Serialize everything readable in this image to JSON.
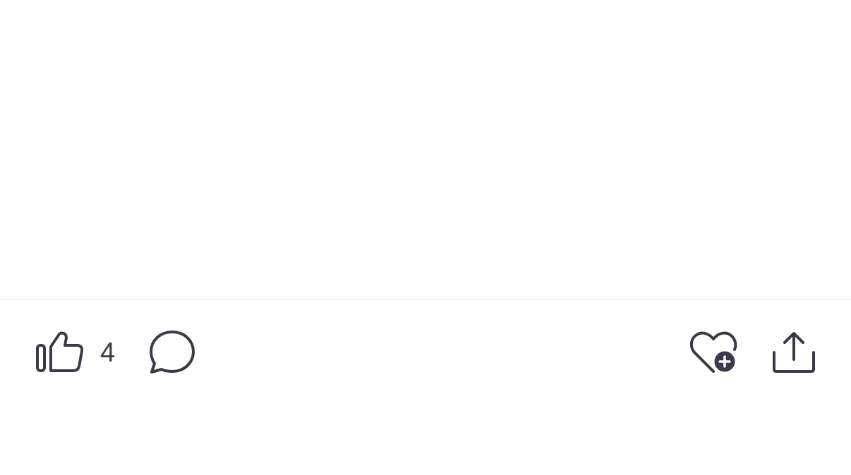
{
  "action_bar": {
    "like_count": "4"
  }
}
